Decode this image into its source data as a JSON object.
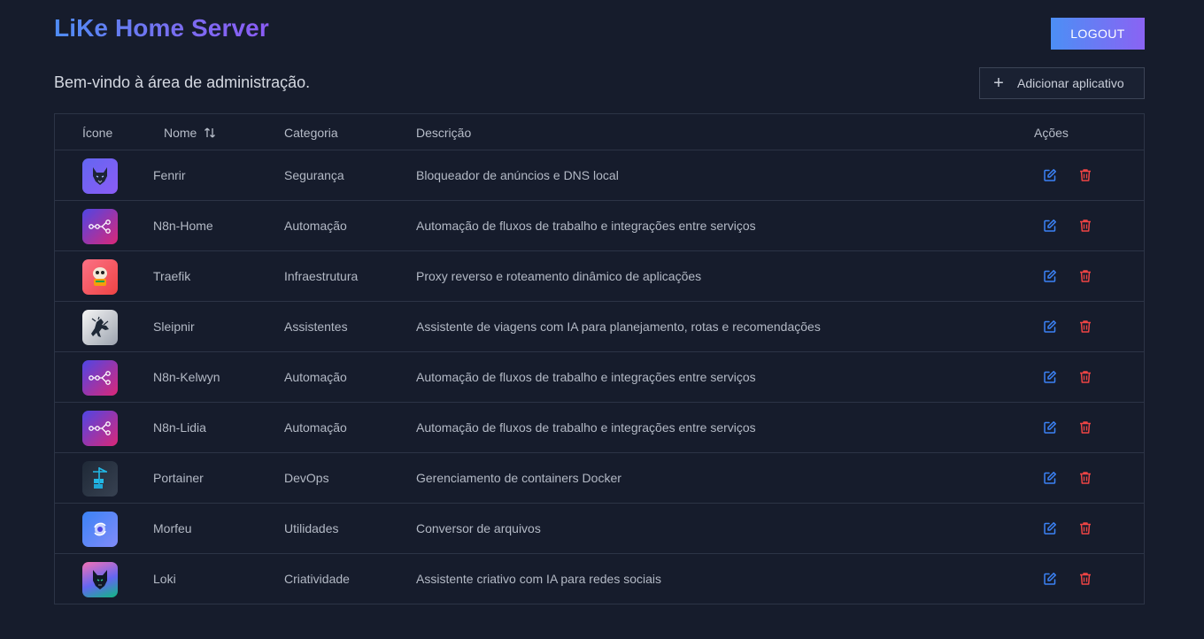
{
  "header": {
    "title": "LiKe Home Server",
    "logout_label": "LOGOUT"
  },
  "welcome_text": "Bem-vindo à área de administração.",
  "add_button_label": "Adicionar aplicativo",
  "table": {
    "columns": {
      "icon": "Ícone",
      "name": "Nome",
      "category": "Categoria",
      "description": "Descrição",
      "actions": "Ações"
    },
    "rows": [
      {
        "name": "Fenrir",
        "category": "Segurança",
        "description": "Bloqueador de anúncios e DNS local",
        "icon": "wolf-icon"
      },
      {
        "name": "N8n-Home",
        "category": "Automação",
        "description": "Automação de fluxos de trabalho e integrações entre serviços",
        "icon": "n8n-workflow-icon"
      },
      {
        "name": "Traefik",
        "category": "Infraestrutura",
        "description": "Proxy reverso e roteamento dinâmico de aplicações",
        "icon": "traefik-gopher-icon"
      },
      {
        "name": "Sleipnir",
        "category": "Assistentes",
        "description": "Assistente de viagens com IA para planejamento, rotas e recomendações",
        "icon": "horse-icon"
      },
      {
        "name": "N8n-Kelwyn",
        "category": "Automação",
        "description": "Automação de fluxos de trabalho e integrações entre serviços",
        "icon": "n8n-workflow-icon"
      },
      {
        "name": "N8n-Lidia",
        "category": "Automação",
        "description": "Automação de fluxos de trabalho e integrações entre serviços",
        "icon": "n8n-workflow-icon"
      },
      {
        "name": "Portainer",
        "category": "DevOps",
        "description": "Gerenciamento de containers Docker",
        "icon": "portainer-crane-icon"
      },
      {
        "name": "Morfeu",
        "category": "Utilidades",
        "description": "Conversor de arquivos",
        "icon": "converter-icon"
      },
      {
        "name": "Loki",
        "category": "Criatividade",
        "description": "Assistente criativo com IA para redes sociais",
        "icon": "loki-mask-icon"
      }
    ]
  },
  "colors": {
    "background": "#161c2c",
    "accent_blue": "#4f8df5",
    "accent_purple": "#8b5cf6",
    "edit_icon": "#3b82f6",
    "delete_icon": "#ef4444",
    "border": "#2c3446"
  }
}
